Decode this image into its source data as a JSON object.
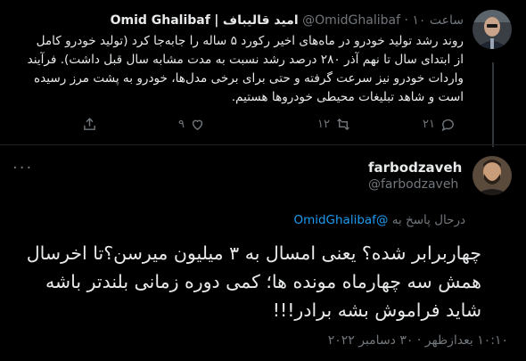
{
  "parent_tweet": {
    "display_name_en": "Omid Ghalibaf",
    "separator": "|",
    "display_name_fa": "امید قالیباف",
    "handle": "@OmidGhalibaf",
    "dot": "·",
    "time": "۱۰ ساعت",
    "text": "روند رشد تولید خودرو در ماه‌های اخیر رکورد ۵ ساله را جابه‌جا کرد (تولید خودرو کامل از ابتدای سال تا نهم آذر ۲۸۰ درصد رشد نسبت به مدت مشابه سال قبل داشت). فرآیند واردات خودرو نیز سرعت گرفته و حتی برای برخی مدل‌ها، خودرو به پشت مرز رسیده است و شاهد تبلیغات محیطی خودروها هستیم.",
    "reply_count": "۲۱",
    "retweet_count": "۱۲",
    "like_count": "۹"
  },
  "reply_tweet": {
    "display_name": "farbodzaveh",
    "handle": "@farbodzaveh",
    "more": "···",
    "replying_to_label": "درحال پاسخ به",
    "replying_to_handle": "@OmidGhalibaf",
    "text": "چهاربرابر شده؟ یعنی امسال به ۳ میلیون میرسن؟تا اخرسال همش سه چهارماه مونده ها؛ کمی دوره زمانی بلندتر باشه شاید فراموش بشه برادر!!!",
    "timestamp": "۱۰:۱۰ بعدازظهر · ۳۰ دسامبر ۲۰۲۲"
  },
  "colors": {
    "background": "#000000",
    "text": "#e7e9ea",
    "muted": "#71767b",
    "link": "#1d9bf0",
    "divider": "#1f2326"
  },
  "icons": [
    "reply-icon",
    "retweet-icon",
    "like-icon",
    "share-icon",
    "more-icon"
  ]
}
